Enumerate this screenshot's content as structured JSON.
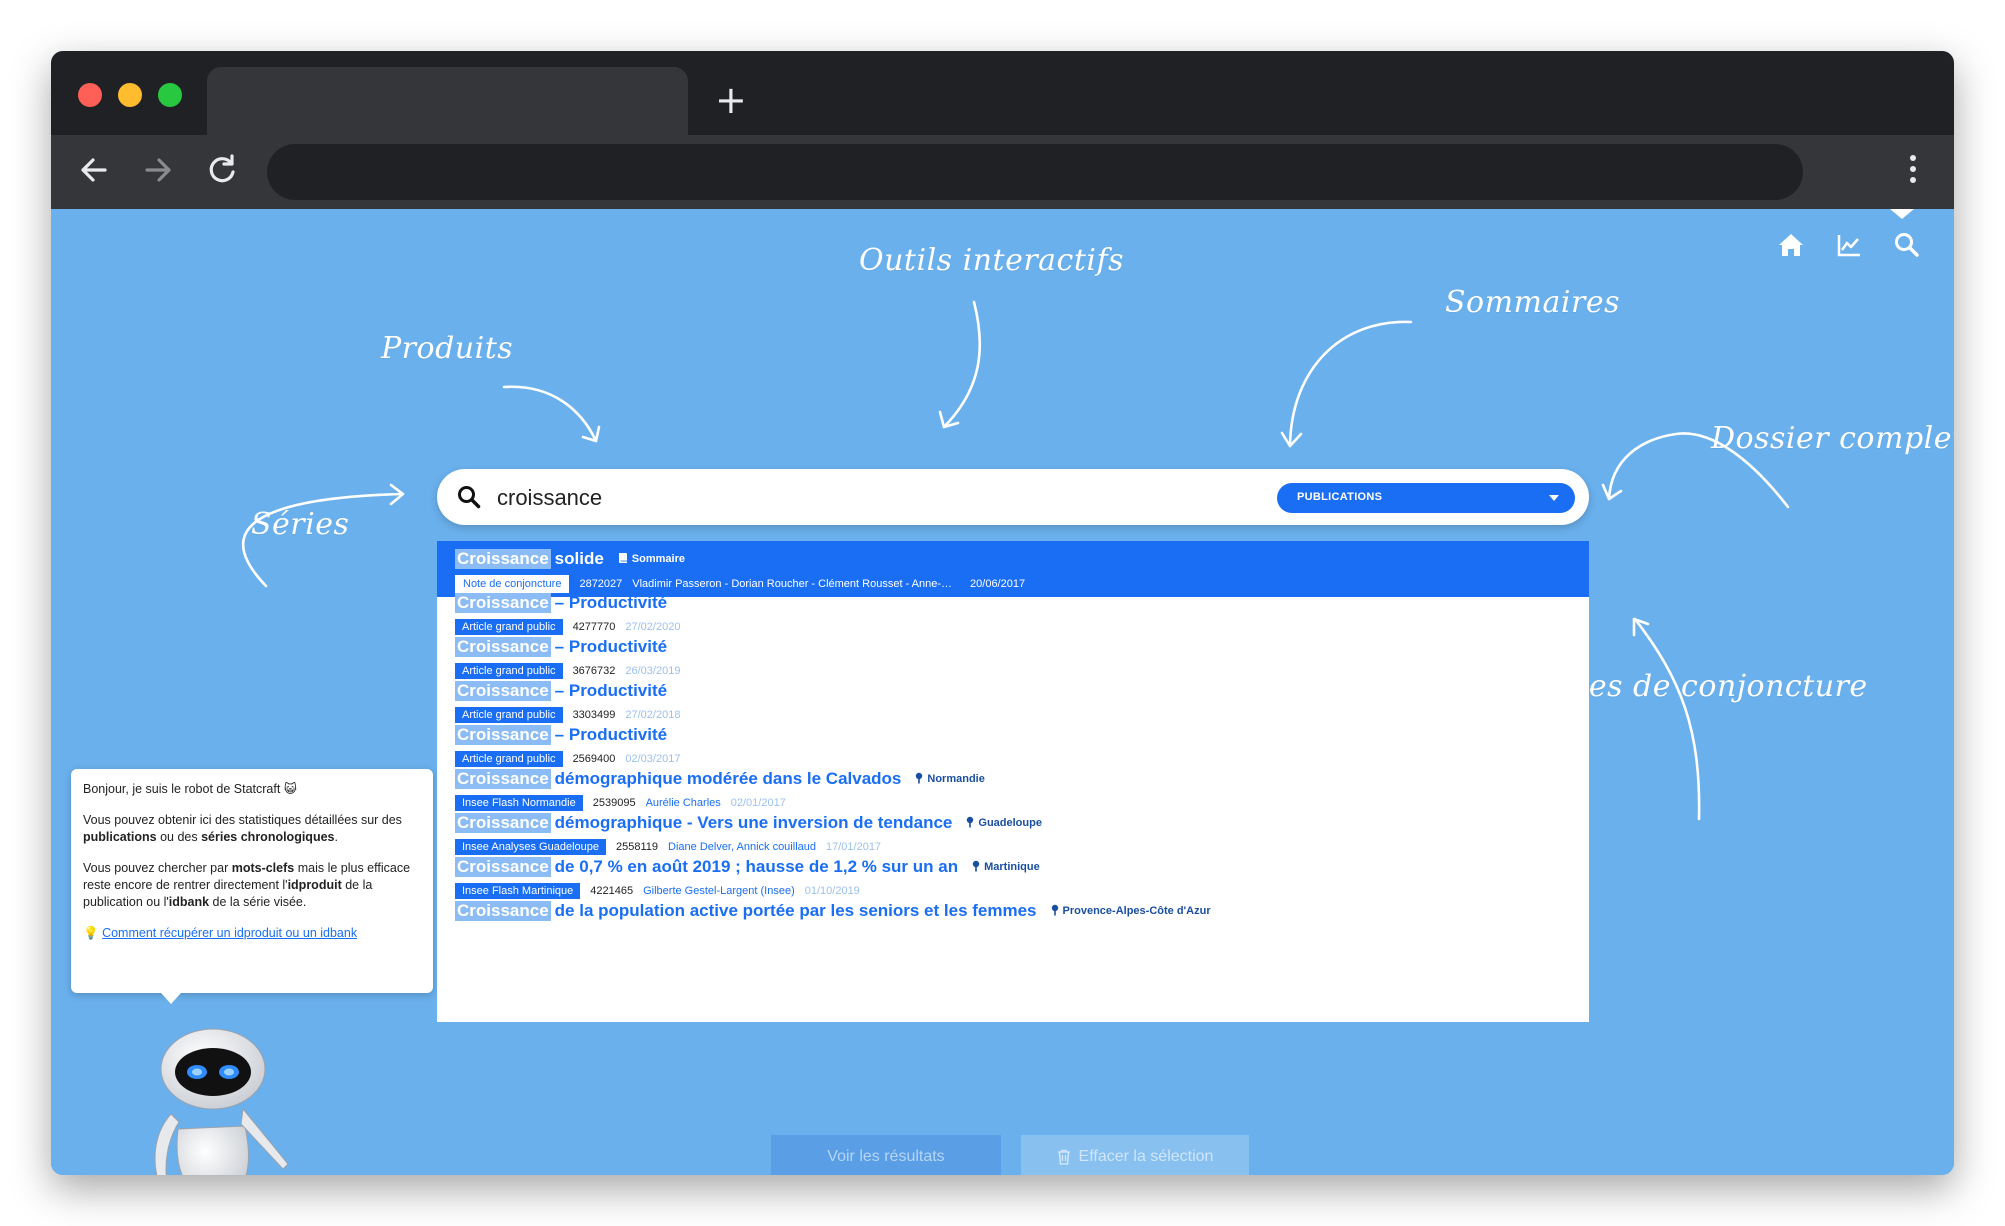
{
  "browser": {
    "traffic_lights": [
      "#fe5f57",
      "#febc2e",
      "#28c840"
    ],
    "new_tab_glyph": "+"
  },
  "annotations": {
    "outils": "Outils interactifs",
    "sommaires": "Sommaires",
    "produits": "Produits",
    "series": "Séries",
    "dossier": "Dossier complet",
    "notes": "Notes de conjoncture"
  },
  "search": {
    "query": "croissance",
    "category": "PUBLICATIONS"
  },
  "results": [
    {
      "highlight": "Croissance",
      "rest": "solide",
      "tag_icon": "book-icon",
      "tag": "Sommaire",
      "badge": "Note de conjoncture",
      "id": "2872027",
      "authors": "Vladimir Passeron - Dorian Roucher - Clément Rousset - Anne-…",
      "date": "20/06/2017",
      "selected": true
    },
    {
      "highlight": "Croissance",
      "rest": "– Productivité",
      "tag_icon": "",
      "tag": "",
      "badge": "Article grand public",
      "id": "4277770",
      "authors": "",
      "date": "27/02/2020"
    },
    {
      "highlight": "Croissance",
      "rest": "– Productivité",
      "tag_icon": "",
      "tag": "",
      "badge": "Article grand public",
      "id": "3676732",
      "authors": "",
      "date": "26/03/2019"
    },
    {
      "highlight": "Croissance",
      "rest": "– Productivité",
      "tag_icon": "",
      "tag": "",
      "badge": "Article grand public",
      "id": "3303499",
      "authors": "",
      "date": "27/02/2018"
    },
    {
      "highlight": "Croissance",
      "rest": "– Productivité",
      "tag_icon": "",
      "tag": "",
      "badge": "Article grand public",
      "id": "2569400",
      "authors": "",
      "date": "02/03/2017"
    },
    {
      "highlight": "Croissance",
      "rest": "démographique modérée dans le Calvados",
      "tag_icon": "map-pin-icon",
      "tag": "Normandie",
      "badge": "Insee Flash Normandie",
      "id": "2539095",
      "authors": "Aurélie Charles",
      "date": "02/01/2017"
    },
    {
      "highlight": "Croissance",
      "rest": "démographique - Vers une inversion de tendance",
      "tag_icon": "map-pin-icon",
      "tag": "Guadeloupe",
      "badge": "Insee Analyses Guadeloupe",
      "id": "2558119",
      "authors": "Diane Delver, Annick couillaud",
      "date": "17/01/2017"
    },
    {
      "highlight": "Croissance",
      "rest": "de 0,7 % en août 2019 ; hausse de 1,2 % sur un an",
      "tag_icon": "map-pin-icon",
      "tag": "Martinique",
      "badge": "Insee Flash Martinique",
      "id": "4221465",
      "authors": "Gilberte Gestel-Largent (Insee)",
      "date": "01/10/2019"
    },
    {
      "highlight": "Croissance",
      "rest": "de la population active portée par les seniors et les femmes",
      "tag_icon": "map-pin-icon",
      "tag": "Provence-Alpes-Côte d'Azur",
      "badge": "",
      "id": "",
      "authors": "",
      "date": ""
    }
  ],
  "buttons": {
    "view": "Voir les résultats",
    "clear": "Effacer la sélection"
  },
  "bot": {
    "greeting": "Bonjour, je suis le robot de Statcraft 😺",
    "p2_a": "Vous pouvez obtenir ici des statistiques détaillées sur des ",
    "p2_b": "publications",
    "p2_c": " ou des ",
    "p2_d": "séries chronologiques",
    "p2_e": ".",
    "p3_a": "Vous pouvez chercher par ",
    "p3_b": "mots-clefs",
    "p3_c": " mais le plus efficace reste encore de rentrer directement l'",
    "p3_d": "idproduit",
    "p3_e": " de la publication ou l'",
    "p3_f": "idbank",
    "p3_g": " de la série visée.",
    "tip_icon": "💡",
    "link": "Comment récupérer un idproduit ou un idbank"
  },
  "colors": {
    "background": "#6ab0ec",
    "accent": "#1a6ef4",
    "highlight": "#8bbcf5"
  }
}
